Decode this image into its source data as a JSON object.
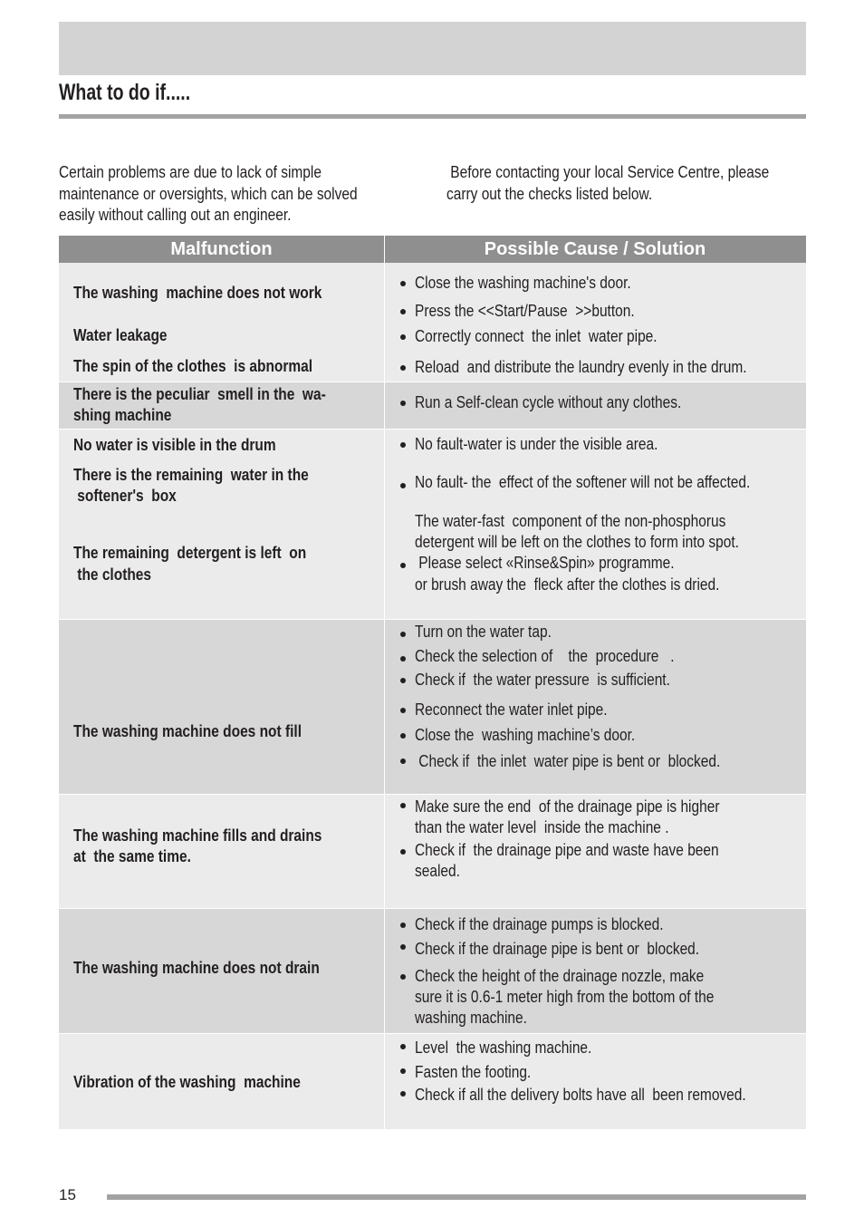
{
  "header": {
    "title": "What to do if....."
  },
  "intro": {
    "left": [
      "Certain problems are due to lack of simple",
      "maintenance or oversights, which can be solved",
      "easily without calling out an engineer."
    ],
    "right": [
      " Before contacting your local Service Centre, please",
      "carry out the checks listed below."
    ]
  },
  "table": {
    "headers": {
      "malfunction": "Malfunction",
      "solution": "Possible Cause / Solution"
    },
    "rows": [
      {
        "malfunction": [
          "The washing  machine does not work",
          "Water leakage",
          "The spin of the clothes  is abnormal"
        ],
        "solution": [
          "Close the washing machine's door.",
          "Press the <<Start/Pause  >>button.",
          "Correctly connect  the inlet  water pipe.",
          "Reload  and distribute the laundry evenly in the drum."
        ]
      },
      {
        "malfunction": [
          "There is the peculiar  smell in the  wa-",
          "shing machine"
        ],
        "solution": [
          "Run a Self-clean cycle without any clothes."
        ]
      },
      {
        "malfunction": [
          "No water is visible in the drum",
          "There is the remaining  water in the",
          " softener's  box",
          "The remaining  detergent is left  on",
          " the clothes"
        ],
        "solution": [
          "No fault-water is under the visible area.",
          "No fault- the  effect of the softener will not be affected.",
          "The water-fast  component of the non-phosphorus",
          "detergent will be left on the clothes to form into spot.",
          " Please select «Rinse&Spin» programme.",
          "or brush away the  fleck after the clothes is dried."
        ]
      },
      {
        "malfunction": [
          "The washing machine does not fill"
        ],
        "solution": [
          "Turn on the water tap.",
          "Check the selection of    the  procedure   .",
          "Check if  the water pressure  is sufficient.",
          "Reconnect the water inlet pipe.",
          "Close the  washing machine’s door.",
          " Check if  the inlet  water pipe is bent or  blocked."
        ]
      },
      {
        "malfunction": [
          "The washing machine fills and drains",
          "at  the same time."
        ],
        "solution": [
          "Make sure the end  of the drainage pipe is higher",
          "than the water level  inside the machine .",
          "Check if  the drainage pipe and waste have been",
          "sealed."
        ]
      },
      {
        "malfunction": [
          "The washing machine does not drain"
        ],
        "solution": [
          "Check if the drainage pumps is blocked.",
          "Check if the drainage pipe is bent or  blocked.",
          "Check the height of the drainage nozzle, make",
          "sure it is 0.6-1 meter high from the bottom of the",
          "washing machine."
        ]
      },
      {
        "malfunction": [
          "Vibration of the washing  machine"
        ],
        "solution": [
          "Level  the washing machine.",
          "Fasten the footing.",
          "Check if all the delivery bolts have all  been removed."
        ]
      }
    ]
  },
  "footer": {
    "page_number": "15"
  },
  "colors": {
    "band": "#d3d3d3",
    "rule": "#a3a3a3",
    "table_header": "#8f8f8f",
    "row_light": "#ebebeb",
    "row_dark": "#d7d7d7"
  }
}
